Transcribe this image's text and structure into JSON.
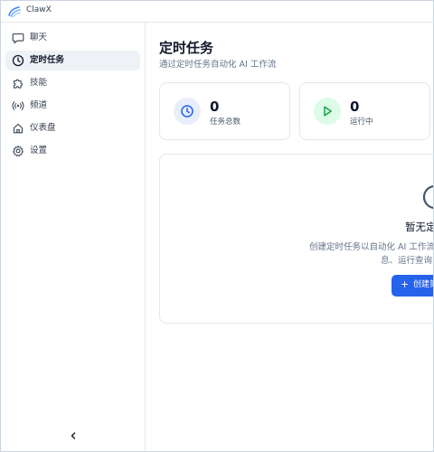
{
  "app": {
    "title": "ClawX",
    "icon": "claw-logo"
  },
  "sidebar": {
    "items": [
      {
        "label": "聊天",
        "icon": "chat-icon",
        "active": false
      },
      {
        "label": "定时任务",
        "icon": "clock-icon",
        "active": true
      },
      {
        "label": "技能",
        "icon": "puzzle-icon",
        "active": false
      },
      {
        "label": "频道",
        "icon": "broadcast-icon",
        "active": false
      },
      {
        "label": "仪表盘",
        "icon": "home-icon",
        "active": false
      },
      {
        "label": "设置",
        "icon": "gear-icon",
        "active": false
      }
    ],
    "collapse_icon": "chevron-left-icon"
  },
  "page": {
    "title": "定时任务",
    "subtitle": "通过定时任务自动化 AI 工作流"
  },
  "stats": [
    {
      "value": "0",
      "label": "任务总数",
      "icon": "clock-icon",
      "color": "#2563eb",
      "bg": "#e8eefb"
    },
    {
      "value": "0",
      "label": "运行中",
      "icon": "play-icon",
      "color": "#16a34a",
      "bg": "#dcfce7"
    }
  ],
  "empty_state": {
    "icon": "clock-icon",
    "title": "暂无定",
    "desc_line1": "创建定时任务以自动化 AI 工作流",
    "desc_line2": "息、运行查询",
    "button_label": "创建第",
    "button_icon": "plus-icon"
  },
  "colors": {
    "accent": "#2563eb",
    "active_nav_bg": "#eef1f5",
    "border": "#e5e7eb"
  }
}
